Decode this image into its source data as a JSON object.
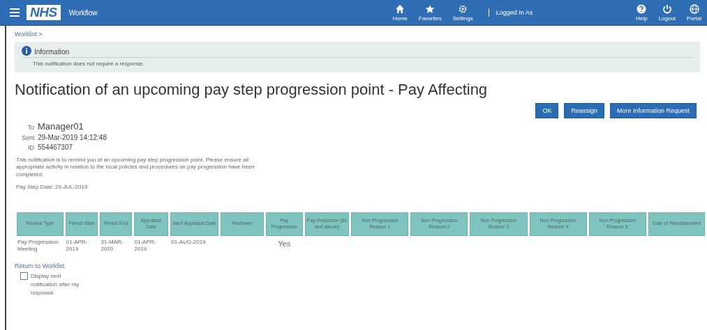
{
  "header": {
    "app": "Workflow",
    "logo": "NHS",
    "nav": [
      {
        "label": "Home",
        "kind": "home"
      },
      {
        "label": "Favorites",
        "kind": "star"
      },
      {
        "label": "Settings",
        "kind": "gear"
      }
    ],
    "user": "Logged In As",
    "tools": [
      {
        "label": "Help",
        "kind": "help"
      },
      {
        "label": "Logout",
        "kind": "power"
      },
      {
        "label": "Portal",
        "kind": "globe"
      }
    ]
  },
  "breadcrumb": "Worklist >",
  "info": {
    "title": "Information",
    "message": "This notification does not require a response."
  },
  "title": "Notification of an upcoming pay step progression point - Pay Affecting",
  "buttons": [
    "OK",
    "Reassign",
    "More Information Request"
  ],
  "details": [
    {
      "label": "To",
      "value": "Manager01",
      "kind": "large"
    },
    {
      "label": "Sent",
      "value": "29-Mar-2019 14:12:48",
      "kind": "small"
    },
    {
      "label": "ID",
      "value": "554467307",
      "kind": "small"
    }
  ],
  "message": "This notification is to remind you of an upcoming pay step progression point. Please ensure all appropriate activity in relation to the local policies and procedures on pay progression have been completed.",
  "pay_step_date": "Pay Step Date: 29-JUL-2019",
  "table": {
    "columns": [
      "Review Type",
      "Period Start",
      "Period End",
      "Appraisal Date",
      "Next Appraisal Date",
      "Reviewer",
      "Pay Progression",
      "Pay Reduction (8c and above)",
      "Non Progression Reason 1",
      "Non Progression Reason 2",
      "Non Progression Reason 3",
      "Non Progression Reason 4",
      "Non Progression Reason 5",
      "Date of Reinstatement"
    ],
    "rows": [
      [
        "Pay Progression Meeting",
        "01-APR-2019",
        "31-MAR-2020",
        "01-APR-2019",
        "01-AUG-2019",
        "",
        "Yes",
        "",
        "",
        "",
        "",
        "",
        "",
        ""
      ]
    ]
  },
  "return_link": "Return to Worklist",
  "display_next": {
    "label": "Display next notification after my response",
    "checked": false
  }
}
